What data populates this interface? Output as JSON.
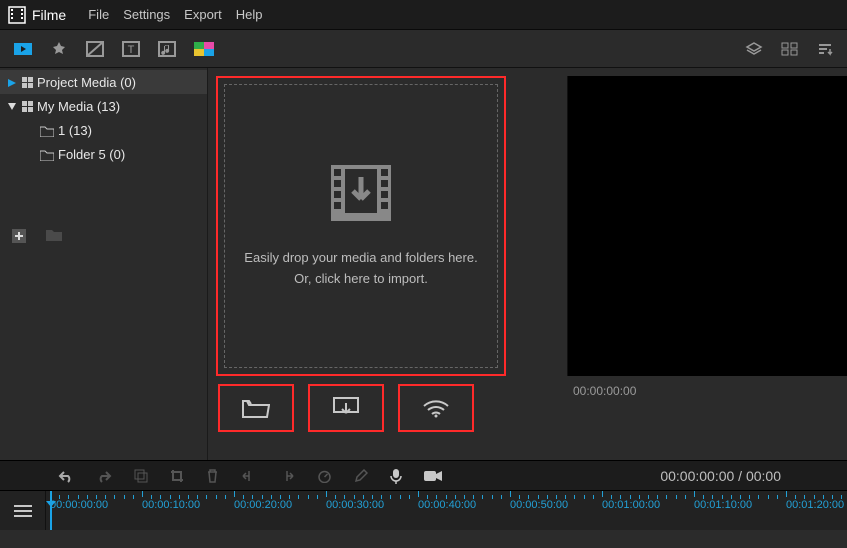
{
  "app": {
    "name": "Filme"
  },
  "menu": {
    "file": "File",
    "settings": "Settings",
    "export": "Export",
    "help": "Help"
  },
  "tree": {
    "project": {
      "label": "Project Media (0)"
    },
    "mymedia": {
      "label": "My Media (13)"
    },
    "child1": {
      "label": "1 (13)"
    },
    "child2": {
      "label": "Folder 5 (0)"
    }
  },
  "dropzone": {
    "line1": "Easily drop your media and folders here.",
    "line2": "Or, click here to import."
  },
  "preview": {
    "time": "00:00:00:00"
  },
  "timebar": {
    "big": "00:00:00:00 / 00:00"
  },
  "ruler": {
    "marks": [
      "00:00:00:00",
      "00:00:10:00",
      "00:00:20:00",
      "00:00:30:00",
      "00:00:40:00",
      "00:00:50:00",
      "00:01:00:00",
      "00:01:10:00",
      "00:01:20:00"
    ]
  }
}
